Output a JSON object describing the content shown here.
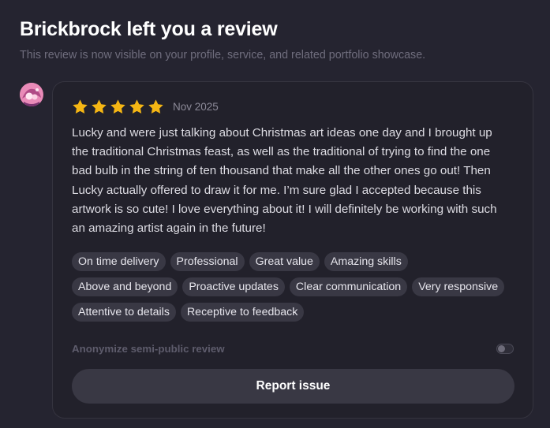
{
  "header": {
    "title": "Brickbrock left you a review",
    "subtitle": "This review is now visible on your profile, service, and related portfolio showcase."
  },
  "review": {
    "rating": 5,
    "rating_max": 5,
    "star_color": "#f5b614",
    "date": "Nov 2025",
    "text": "Lucky and were just talking about Christmas art ideas one day and I brought up the traditional Christmas feast, as well as the traditional of trying to find the one bad bulb in the string of ten thousand that make all the other ones go out! Then Lucky actually offered to draw it for me. I’m sure glad I accepted because this artwork is so cute! I love everything about it! I will definitely be working with such an amazing artist again in the future!",
    "tags": [
      "On time delivery",
      "Professional",
      "Great value",
      "Amazing skills",
      "Above and beyond",
      "Proactive updates",
      "Clear communication",
      "Very responsive",
      "Attentive to details",
      "Receptive to feedback"
    ]
  },
  "anonymize": {
    "label": "Anonymize semi-public review",
    "enabled": false
  },
  "actions": {
    "report_label": "Report issue"
  }
}
